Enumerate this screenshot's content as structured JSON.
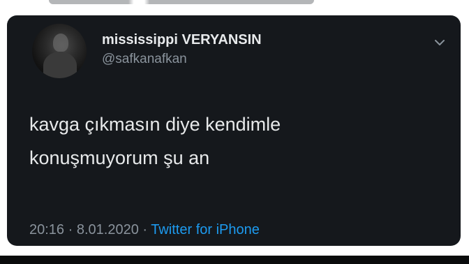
{
  "tweet": {
    "display_name": "mississippi VERYANSIN",
    "handle": "@safkanafkan",
    "text_lines": [
      "kavga çıkmasın diye kendimle",
      "konuşmuyorum şu an"
    ],
    "time": "20:16",
    "separator": "·",
    "date": "8.01.2020",
    "source": "Twitter for iPhone"
  },
  "icons": {
    "menu": "chevron-down-icon"
  },
  "colors": {
    "card_background": "#15181c",
    "primary_text": "#e7e9ea",
    "secondary_text": "#8a939c",
    "link": "#1d9bf0"
  }
}
